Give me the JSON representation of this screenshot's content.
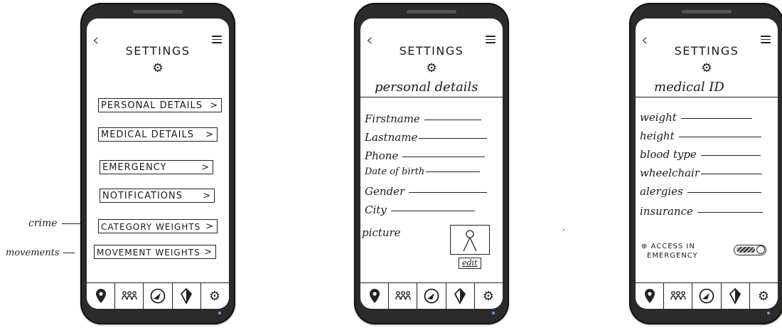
{
  "screen1": {
    "title": "SETTINGS",
    "menu_items": [
      {
        "label": "PERSONAL DETAILS"
      },
      {
        "label": "MEDICAL DETAILS"
      },
      {
        "label": "EMERGENCY"
      },
      {
        "label": "NOTIFICATIONS"
      },
      {
        "label": "CATEGORY WEIGHTS"
      },
      {
        "label": "MOVEMENT WEIGHTS"
      }
    ],
    "chevron": ">"
  },
  "screen2": {
    "title": "SETTINGS",
    "subtitle": "personal details",
    "fields": [
      "Firstname",
      "Lastname",
      "Phone",
      "Date of birth",
      "Gender",
      "City"
    ],
    "picture_label": "picture",
    "edit_label": "edit"
  },
  "screen3": {
    "title": "SETTINGS",
    "subtitle": "medical ID",
    "fields": [
      "weight",
      "height",
      "blood type",
      "wheelchair",
      "alergies",
      "insurance"
    ],
    "toggle_label_line1": "ACCESS IN",
    "toggle_label_line2": "EMERGENCY",
    "toggle_state": true
  },
  "annotations": {
    "crime": "crime",
    "movements": "movements"
  },
  "icons": {
    "back": "chevron-left-icon",
    "menu": "hamburger-menu-icon",
    "settings": "gear-icon",
    "tabs": [
      "map-pin-icon",
      "people-icon",
      "compass-icon",
      "shield-icon",
      "gear-icon"
    ]
  }
}
